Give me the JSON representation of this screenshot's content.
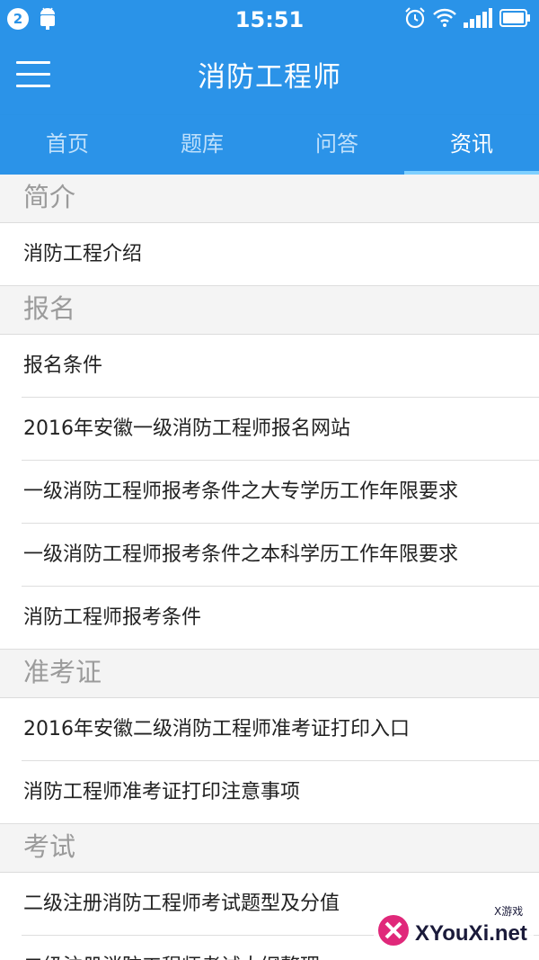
{
  "status_bar": {
    "notification_count": "2",
    "time": "15:51",
    "icons": [
      "android-icon",
      "alarm-icon",
      "wifi-icon",
      "signal-icon",
      "battery-icon"
    ]
  },
  "app_bar": {
    "title": "消防工程师"
  },
  "tabs": [
    {
      "label": "首页"
    },
    {
      "label": "题库"
    },
    {
      "label": "问答"
    },
    {
      "label": "资讯"
    }
  ],
  "active_tab": "资讯",
  "sections": [
    {
      "title": "简介",
      "items": [
        "消防工程介绍"
      ]
    },
    {
      "title": "报名",
      "items": [
        "报名条件",
        "2016年安徽一级消防工程师报名网站",
        "一级消防工程师报考条件之大专学历工作年限要求",
        "一级消防工程师报考条件之本科学历工作年限要求",
        "消防工程师报考条件"
      ]
    },
    {
      "title": "准考证",
      "items": [
        "2016年安徽二级消防工程师准考证打印入口",
        "消防工程师准考证打印注意事项"
      ]
    },
    {
      "title": "考试",
      "items": [
        "二级注册消防工程师考试题型及分值",
        "二级注册消防工程师考试大纲整理"
      ]
    }
  ],
  "watermark": {
    "brand": "XYouXi.net",
    "tag": "X游戏"
  },
  "colors": {
    "primary": "#2b93e8",
    "indicator": "#7fd0ff"
  }
}
